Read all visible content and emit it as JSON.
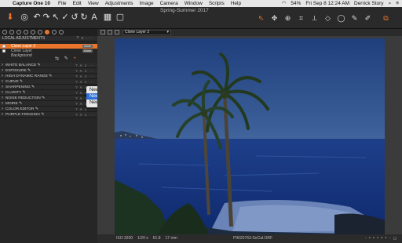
{
  "menubar": {
    "apple": "",
    "app": "Capture One 10",
    "items": [
      "File",
      "Edit",
      "View",
      "Adjustments",
      "Image",
      "Camera",
      "Window",
      "Scripts",
      "Help"
    ],
    "battery": "54%",
    "datetime": "Fri Sep 8  12:24 AM",
    "user": "Derrick Story"
  },
  "toolbar": {
    "title": "Spring-Summer 2017"
  },
  "left_panel": {
    "section_title": "LOCAL ADJUSTMENTS",
    "layers": [
      {
        "name": "Clone Layer 2",
        "badge": "Clone",
        "selected": true
      },
      {
        "name": "Clone Layer",
        "badge": "Clone",
        "selected": false
      },
      {
        "name": "Background",
        "badge": "",
        "selected": false
      }
    ],
    "adjustments": [
      "WHITE BALANCE",
      "EXPOSURE",
      "HIGH DYNAMIC RANGE",
      "CURVE",
      "SHARPENING",
      "CLARITY",
      "NOISE REDUCTION",
      "MOIRE",
      "COLOR EDITOR",
      "PURPLE FRINGING"
    ]
  },
  "popup_menu": {
    "items": [
      "New Layer",
      "New Clone Layer",
      "New Heal Layer"
    ],
    "highlighted": "New Clone Layer"
  },
  "viewer": {
    "layer_select": "Clone Layer 2"
  },
  "status": {
    "iso": "ISO 3200",
    "shutter": "1/20 s",
    "aperture": "f/1.8",
    "focal": "17 mm",
    "filename": "P9020763-SoCal.ORF"
  },
  "colors": {
    "accent": "#e8752b",
    "highlight": "#2d6fd8"
  }
}
